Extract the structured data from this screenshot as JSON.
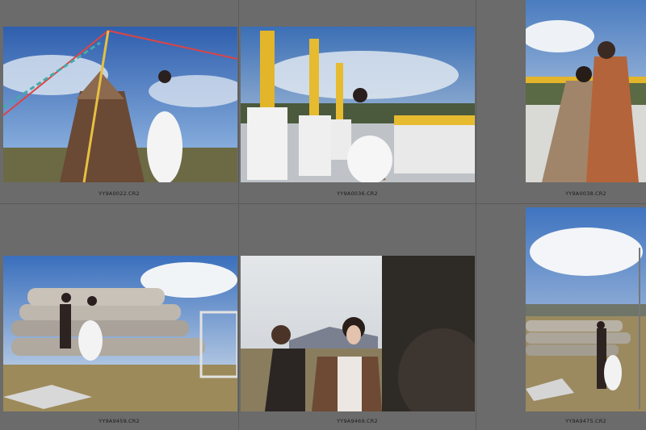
{
  "grid": {
    "cells": [
      {
        "filename": "YY9A0022.CR2"
      },
      {
        "filename": "YY9A0036.CR2"
      },
      {
        "filename": "YY9A0038.CR2"
      },
      {
        "filename": "YY9A9459.CR2"
      },
      {
        "filename": "YY9A9469.CR2"
      },
      {
        "filename": "YY9A9475.CR2"
      }
    ]
  },
  "colors": {
    "panel_bg": "#6b6b6b",
    "cell_divider": "#5a5a5a",
    "label_text": "#1c1c1c"
  }
}
